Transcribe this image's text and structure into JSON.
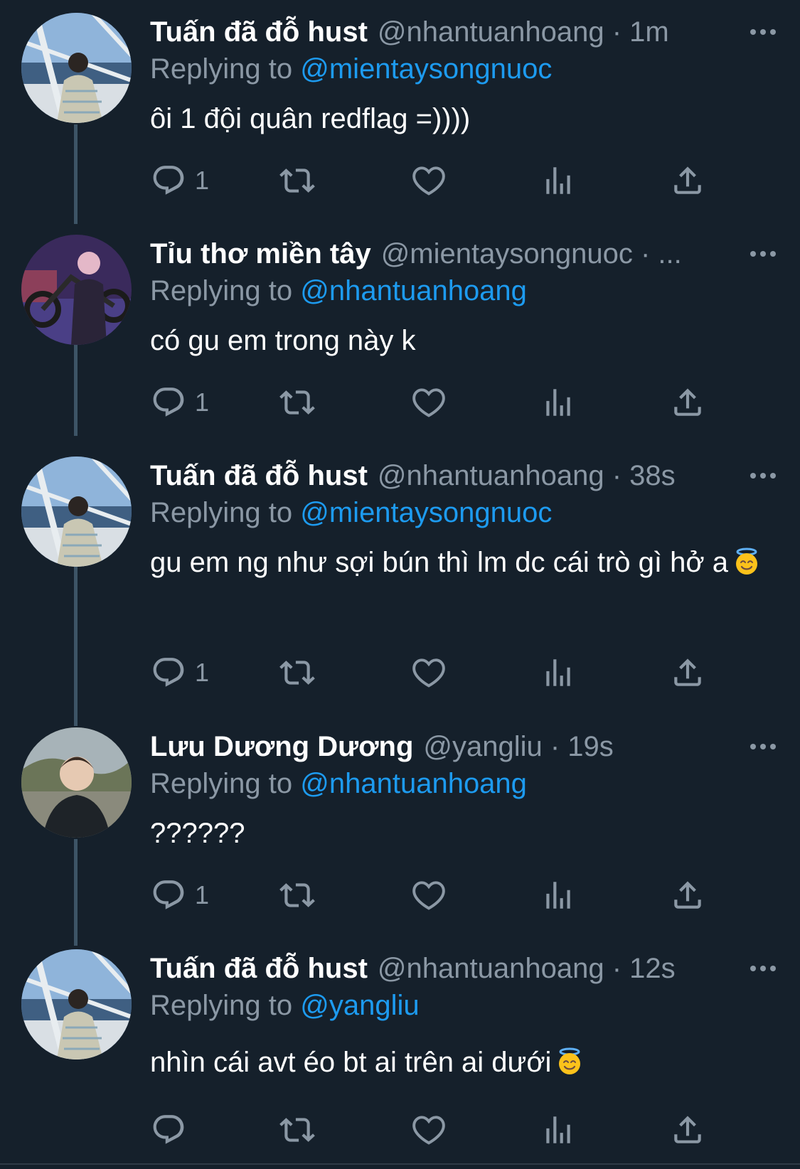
{
  "colors": {
    "background": "#15202b",
    "text_primary": "#ffffff",
    "text_secondary": "#8b98a5",
    "mention": "#1d9bf0",
    "thread_line": "#3d5466"
  },
  "icons": [
    "more-options-icon",
    "reply-icon",
    "retweet-icon",
    "like-icon",
    "views-icon",
    "share-icon",
    "smiling-face-with-halo-emoji"
  ],
  "tweets": [
    {
      "name": "Tuấn đã đỗ hust",
      "meta": "@nhantuanhoang · 1m",
      "replying_prefix": "Replying to",
      "replying_to": "@mientaysongnuoc",
      "text": "ôi 1 đội quân redflag =))))",
      "reply_count": "1",
      "avatar": "boat-photo"
    },
    {
      "name": "Tỉu thơ miền tây",
      "meta": "@mientaysongnuoc · ...",
      "replying_prefix": "Replying to",
      "replying_to": "@nhantuanhoang",
      "text": "có gu em trong này k",
      "reply_count": "1",
      "avatar": "motorbike-photo"
    },
    {
      "name": "Tuấn đã đỗ hust",
      "meta": "@nhantuanhoang · 38s",
      "replying_prefix": "Replying to",
      "replying_to": "@mientaysongnuoc",
      "text": "gu em ng như sợi bún thì lm dc cái trò gì hở a",
      "reply_count": "1",
      "avatar": "boat-photo"
    },
    {
      "name": "Lưu Dương Dương",
      "meta": "@yangliu · 19s",
      "replying_prefix": "Replying to",
      "replying_to": "@nhantuanhoang",
      "text": "??????",
      "reply_count": "1",
      "avatar": "outdoor-photo"
    },
    {
      "name": "Tuấn đã đỗ hust",
      "meta": "@nhantuanhoang · 12s",
      "replying_prefix": "Replying to",
      "replying_to": "@yangliu",
      "text": "nhìn cái avt éo bt ai trên ai dưới",
      "reply_count": "",
      "avatar": "boat-photo"
    }
  ]
}
